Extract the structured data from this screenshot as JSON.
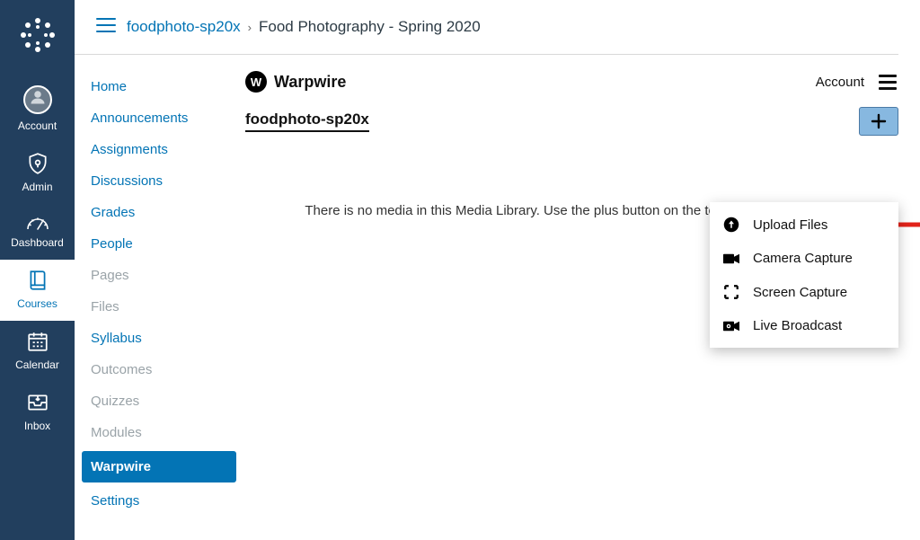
{
  "rail": {
    "account": "Account",
    "admin": "Admin",
    "dashboard": "Dashboard",
    "courses": "Courses",
    "calendar": "Calendar",
    "inbox": "Inbox"
  },
  "breadcrumb": {
    "course_code": "foodphoto-sp20x",
    "course_title": "Food Photography - Spring 2020"
  },
  "coursenav": [
    {
      "label": "Home",
      "dim": false
    },
    {
      "label": "Announcements",
      "dim": false
    },
    {
      "label": "Assignments",
      "dim": false
    },
    {
      "label": "Discussions",
      "dim": false
    },
    {
      "label": "Grades",
      "dim": false
    },
    {
      "label": "People",
      "dim": false
    },
    {
      "label": "Pages",
      "dim": true
    },
    {
      "label": "Files",
      "dim": true
    },
    {
      "label": "Syllabus",
      "dim": false
    },
    {
      "label": "Outcomes",
      "dim": true
    },
    {
      "label": "Quizzes",
      "dim": true
    },
    {
      "label": "Modules",
      "dim": true
    },
    {
      "label": "Warpwire",
      "dim": false,
      "sel": true
    },
    {
      "label": "Settings",
      "dim": false
    }
  ],
  "warpwire": {
    "brand": "Warpwire",
    "account_label": "Account",
    "library_title": "foodphoto-sp20x",
    "empty_text": "There is no media in this Media Library. Use the plus button on the top right to add media.",
    "menu": {
      "upload": "Upload Files",
      "camera": "Camera Capture",
      "screen": "Screen Capture",
      "live": "Live Broadcast"
    }
  }
}
